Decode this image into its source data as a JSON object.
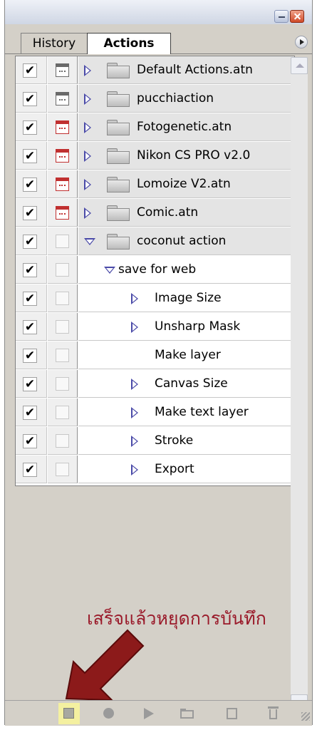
{
  "tabs": [
    {
      "label": "History",
      "active": false
    },
    {
      "label": "Actions",
      "active": true
    }
  ],
  "rows": [
    {
      "kind": "set",
      "label": "Default Actions.atn",
      "checked": true,
      "dialog": "on",
      "expanded": false
    },
    {
      "kind": "set",
      "label": "pucchiaction",
      "checked": true,
      "dialog": "on",
      "expanded": false
    },
    {
      "kind": "set",
      "label": "Fotogenetic.atn",
      "checked": true,
      "dialog": "partial",
      "expanded": false
    },
    {
      "kind": "set",
      "label": "Nikon CS PRO v2.0",
      "checked": true,
      "dialog": "partial",
      "expanded": false
    },
    {
      "kind": "set",
      "label": "Lomoize V2.atn",
      "checked": true,
      "dialog": "partial",
      "expanded": false
    },
    {
      "kind": "set",
      "label": "Comic.atn",
      "checked": true,
      "dialog": "partial",
      "expanded": false
    },
    {
      "kind": "set",
      "label": "coconut action",
      "checked": true,
      "dialog": "off",
      "expanded": true
    },
    {
      "kind": "action",
      "label": "save for web",
      "checked": true,
      "dialog": "off",
      "expanded": true
    },
    {
      "kind": "step",
      "label": "Image Size",
      "checked": true,
      "dialog": "off",
      "has_children": true
    },
    {
      "kind": "step",
      "label": "Unsharp Mask",
      "checked": true,
      "dialog": "off",
      "has_children": true
    },
    {
      "kind": "step",
      "label": "Make layer",
      "checked": true,
      "dialog": "off",
      "has_children": false
    },
    {
      "kind": "step",
      "label": "Canvas Size",
      "checked": true,
      "dialog": "off",
      "has_children": true
    },
    {
      "kind": "step",
      "label": "Make text layer",
      "checked": true,
      "dialog": "off",
      "has_children": true
    },
    {
      "kind": "step",
      "label": "Stroke",
      "checked": true,
      "dialog": "off",
      "has_children": true
    },
    {
      "kind": "step",
      "label": "Export",
      "checked": true,
      "dialog": "off",
      "has_children": true
    }
  ],
  "check_mark": "✔",
  "annotation": {
    "text": "เสร็จแล้วหยุดการบันทึก",
    "color": "#9a1a2a"
  },
  "toolbar": {
    "buttons": [
      {
        "name": "stop-icon",
        "highlighted": true
      },
      {
        "name": "record-icon"
      },
      {
        "name": "play-icon"
      },
      {
        "name": "new-set-icon"
      },
      {
        "name": "new-action-icon"
      },
      {
        "name": "trash-icon"
      }
    ]
  },
  "colors": {
    "dialog_partial": "#c03030",
    "expand_triangle": "#4a4aa8",
    "highlight": "#f4f0a0"
  }
}
